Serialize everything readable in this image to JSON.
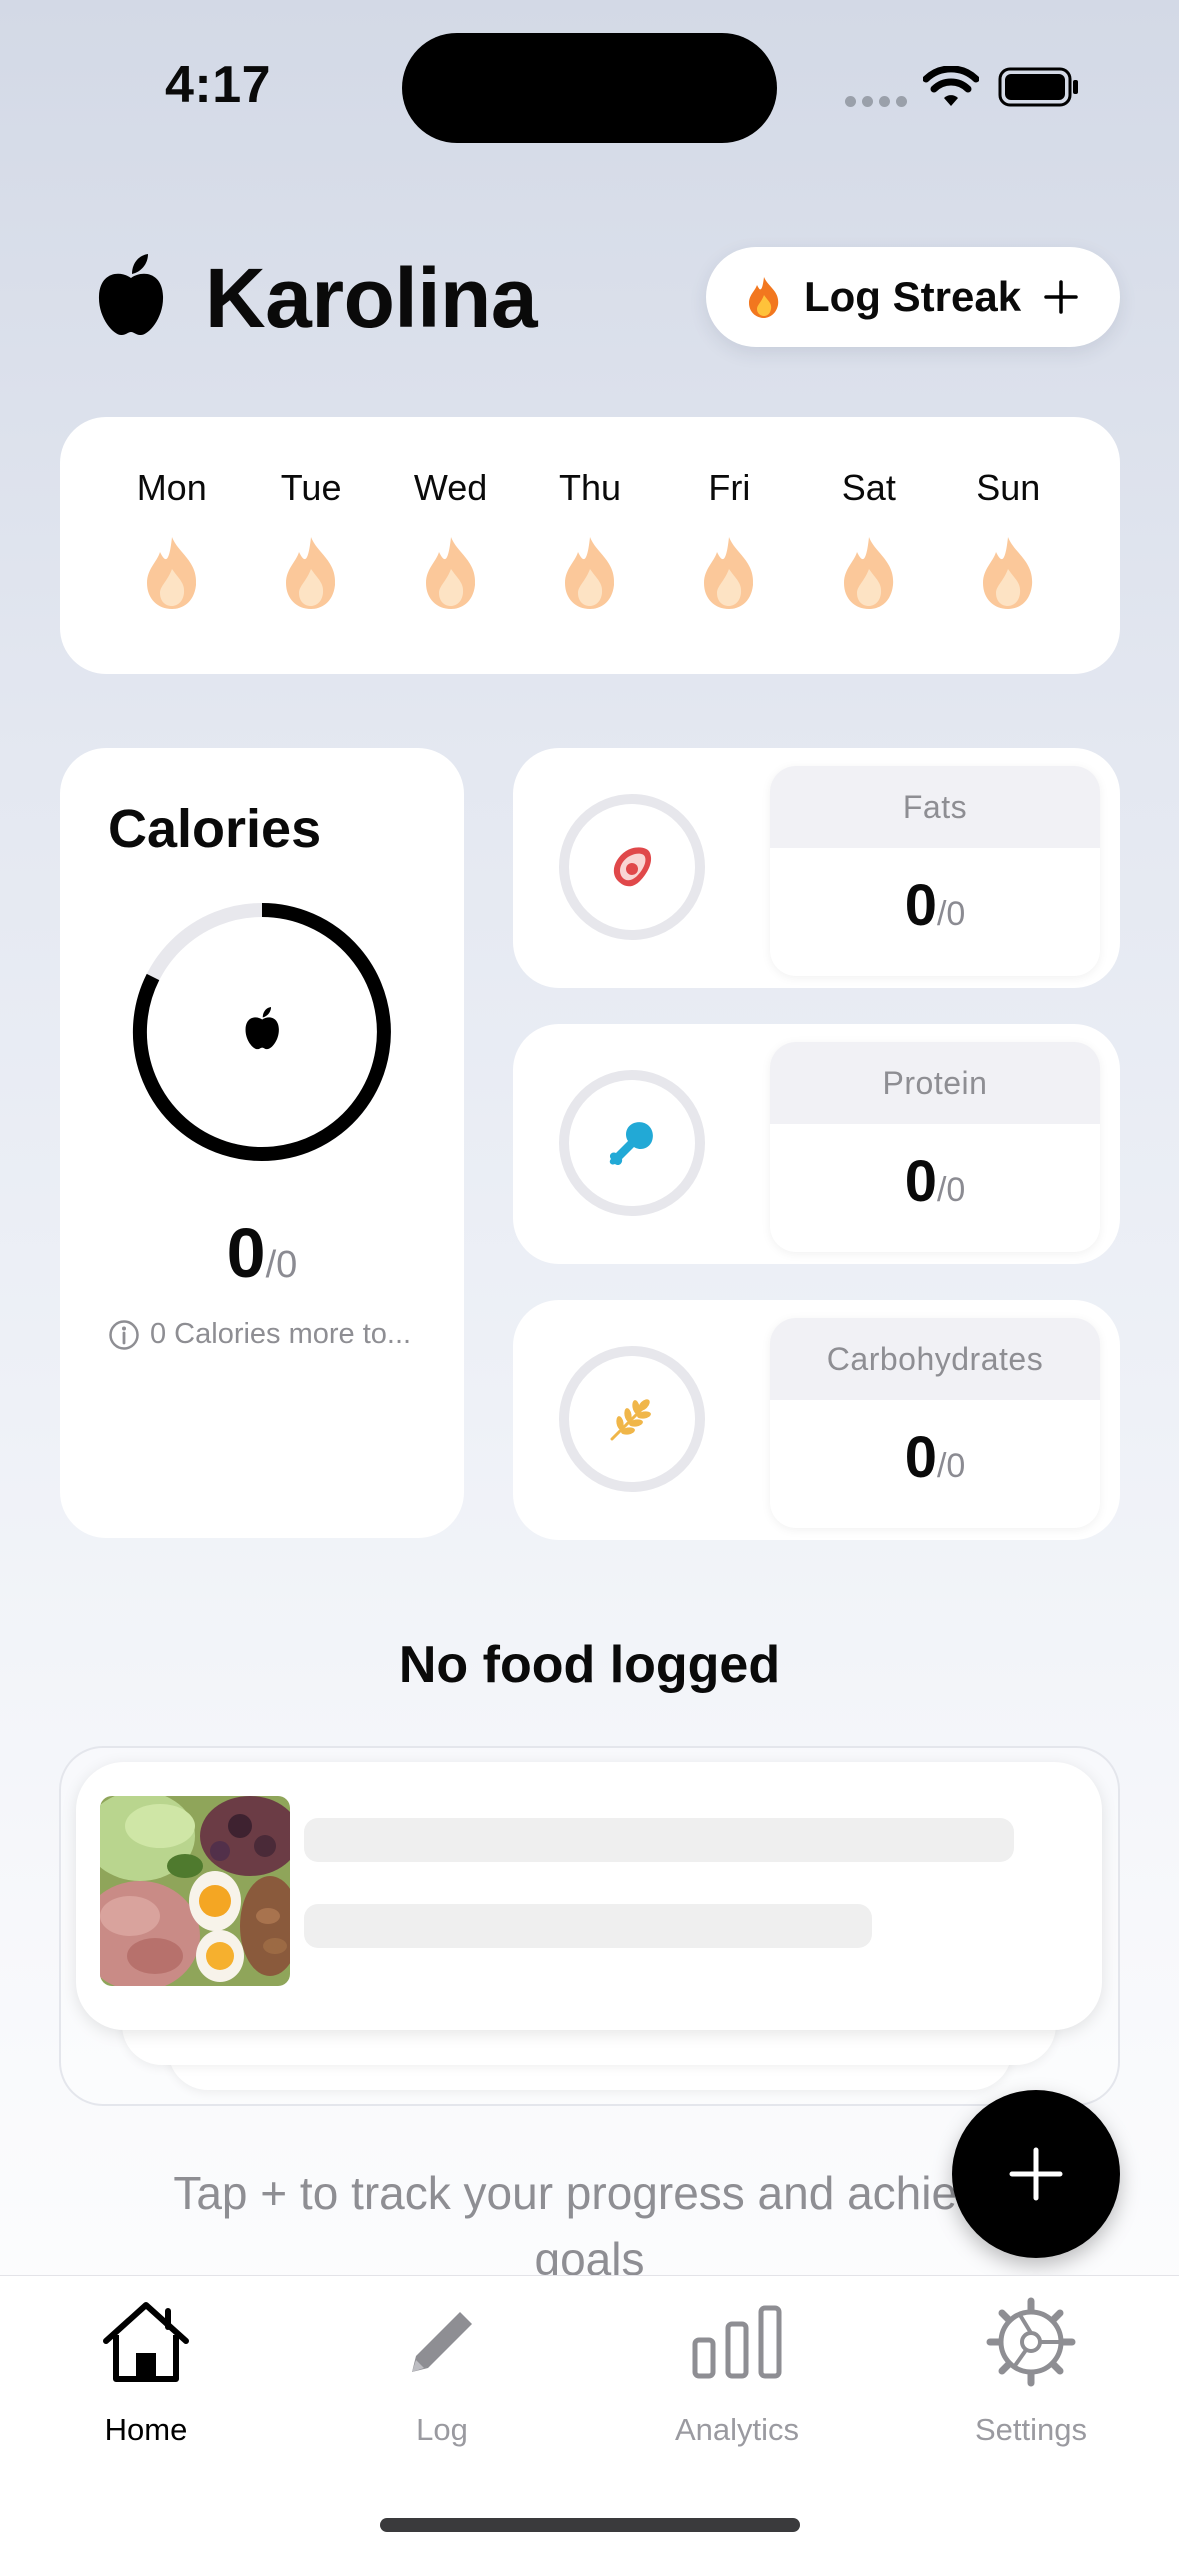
{
  "status_bar": {
    "time": "4:17"
  },
  "header": {
    "user_name": "Karolina",
    "streak_button_label": "Log Streak"
  },
  "week": {
    "days": [
      {
        "label": "Mon"
      },
      {
        "label": "Tue"
      },
      {
        "label": "Wed"
      },
      {
        "label": "Thu"
      },
      {
        "label": "Fri"
      },
      {
        "label": "Sat"
      },
      {
        "label": "Sun"
      }
    ]
  },
  "calories": {
    "title": "Calories",
    "value": "0",
    "goal": "/0",
    "note": "0 Calories more to..."
  },
  "macros": [
    {
      "label": "Fats",
      "value": "0",
      "goal": "/0",
      "icon": "avocado-icon",
      "color": "#e0484a"
    },
    {
      "label": "Protein",
      "value": "0",
      "goal": "/0",
      "icon": "drumstick-icon",
      "color": "#22a9d6"
    },
    {
      "label": "Carbohydrates",
      "value": "0",
      "goal": "/0",
      "icon": "wheat-icon",
      "color": "#f0b649"
    }
  ],
  "empty_state": {
    "title": "No food logged",
    "hint_line1": "Tap + to track your progress and achieve",
    "hint_line2": "goals"
  },
  "tabs": [
    {
      "label": "Home",
      "active": true
    },
    {
      "label": "Log",
      "active": false
    },
    {
      "label": "Analytics",
      "active": false
    },
    {
      "label": "Settings",
      "active": false
    }
  ],
  "colors": {
    "accent": "#000000",
    "flame_inactive": "#f9c79c",
    "muted": "#8e8e93"
  }
}
